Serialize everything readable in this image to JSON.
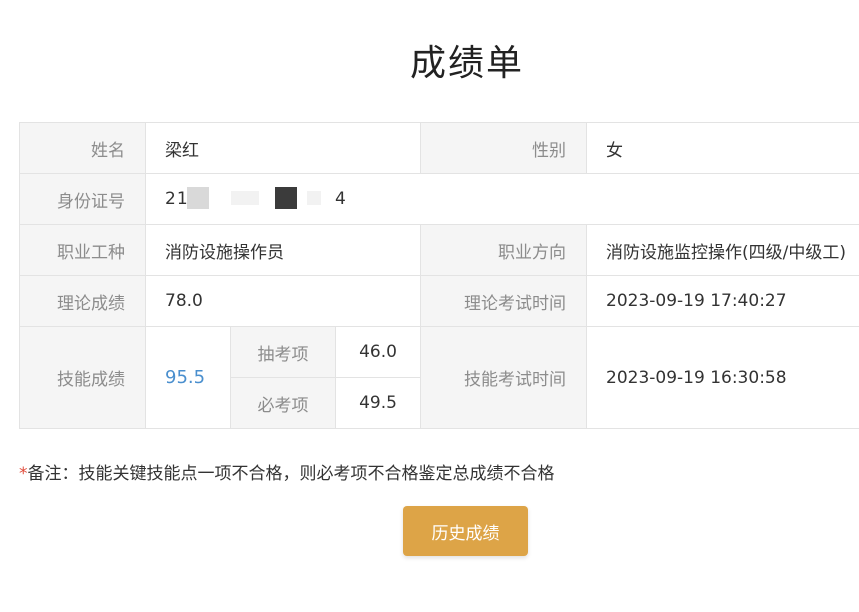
{
  "page": {
    "title": "成绩单"
  },
  "record": {
    "name_label": "姓名",
    "name": "梁红",
    "gender_label": "性别",
    "gender": "女",
    "id_label": "身份证号",
    "id_prefix": "21",
    "id_suffix": "4",
    "occupation_label": "职业工种",
    "occupation": "消防设施操作员",
    "direction_label": "职业方向",
    "direction": "消防设施监控操作(四级/中级工)",
    "theory_score_label": "理论成绩",
    "theory_score": "78.0",
    "theory_time_label": "理论考试时间",
    "theory_time": "2023-09-19 17:40:27",
    "skill_score_label": "技能成绩",
    "skill_score": "95.5",
    "sampled_item_label": "抽考项",
    "sampled_item_score": "46.0",
    "required_item_label": "必考项",
    "required_item_score": "49.5",
    "skill_time_label": "技能考试时间",
    "skill_time": "2023-09-19 16:30:58"
  },
  "remark": {
    "star": "*",
    "text": "备注：技能关键技能点一项不合格，则必考项不合格鉴定总成绩不合格"
  },
  "actions": {
    "history_label": "历史成绩"
  },
  "colors": {
    "button": "#dda447",
    "skill_score": "#4a8fce",
    "label_bg": "#f5f5f5",
    "star": "#e04b3a"
  }
}
